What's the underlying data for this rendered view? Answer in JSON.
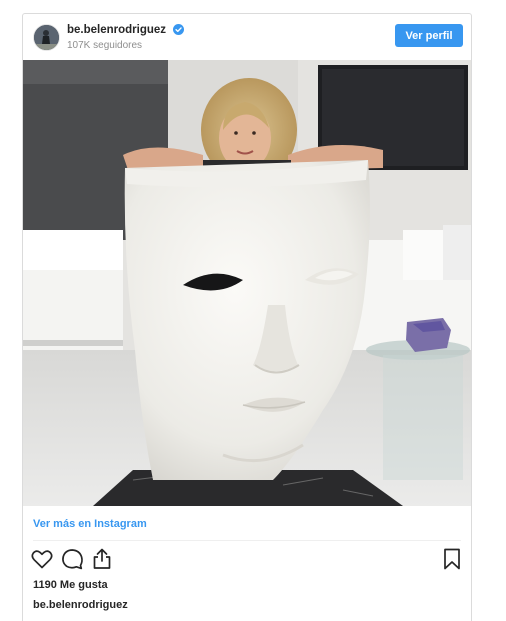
{
  "post": {
    "username": "be.belenrodriguez",
    "followers": "107K seguidores",
    "follow_label": "Ver perfil",
    "more_link": "Ver más en Instagram",
    "likes": "1190 Me gusta",
    "caption_user": "be.belenrodriguez"
  },
  "colors": {
    "accent": "#3897f0",
    "text": "#262626",
    "muted": "#8e8e8e"
  },
  "icons": [
    "verified-badge-icon",
    "heart-icon",
    "comment-icon",
    "share-icon",
    "bookmark-icon"
  ]
}
